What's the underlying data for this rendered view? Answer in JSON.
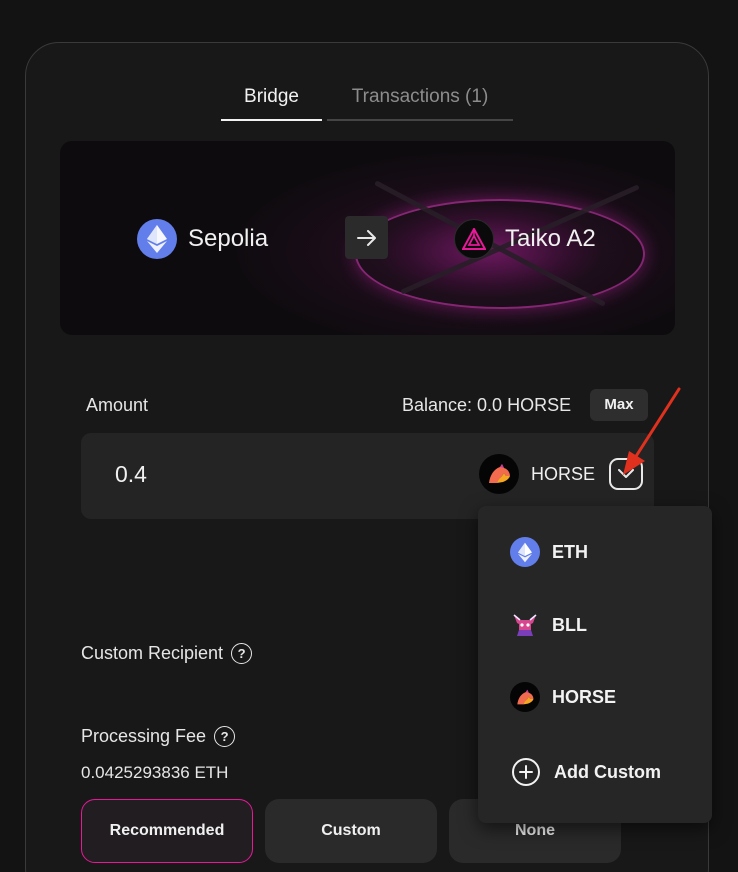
{
  "tabs": [
    {
      "label": "Bridge"
    },
    {
      "label": "Transactions (1)"
    }
  ],
  "chains": {
    "from": {
      "name": "Sepolia",
      "icon": "ethereum-icon"
    },
    "to": {
      "name": "Taiko A2",
      "icon": "taiko-icon"
    },
    "swap_icon": "arrow-right-icon"
  },
  "amount": {
    "label": "Amount",
    "balance": "Balance: 0.0 HORSE",
    "max_label": "Max",
    "value": "0.4",
    "token": "HORSE",
    "token_icon": "horse-icon"
  },
  "dropdown": {
    "items": [
      {
        "label": "ETH",
        "icon": "ethereum-icon"
      },
      {
        "label": "BLL",
        "icon": "bull-icon"
      },
      {
        "label": "HORSE",
        "icon": "horse-icon"
      }
    ],
    "add_custom_label": "Add Custom"
  },
  "recipient": {
    "label": "Custom Recipient"
  },
  "fee": {
    "label": "Processing Fee",
    "value": "0.0425293836 ETH",
    "options": [
      "Recommended",
      "Custom",
      "None"
    ],
    "selected": "Recommended"
  },
  "colors": {
    "accent": "#e81899",
    "eth": "#627eea",
    "background": "#131313",
    "annotation": "#e0311f"
  }
}
